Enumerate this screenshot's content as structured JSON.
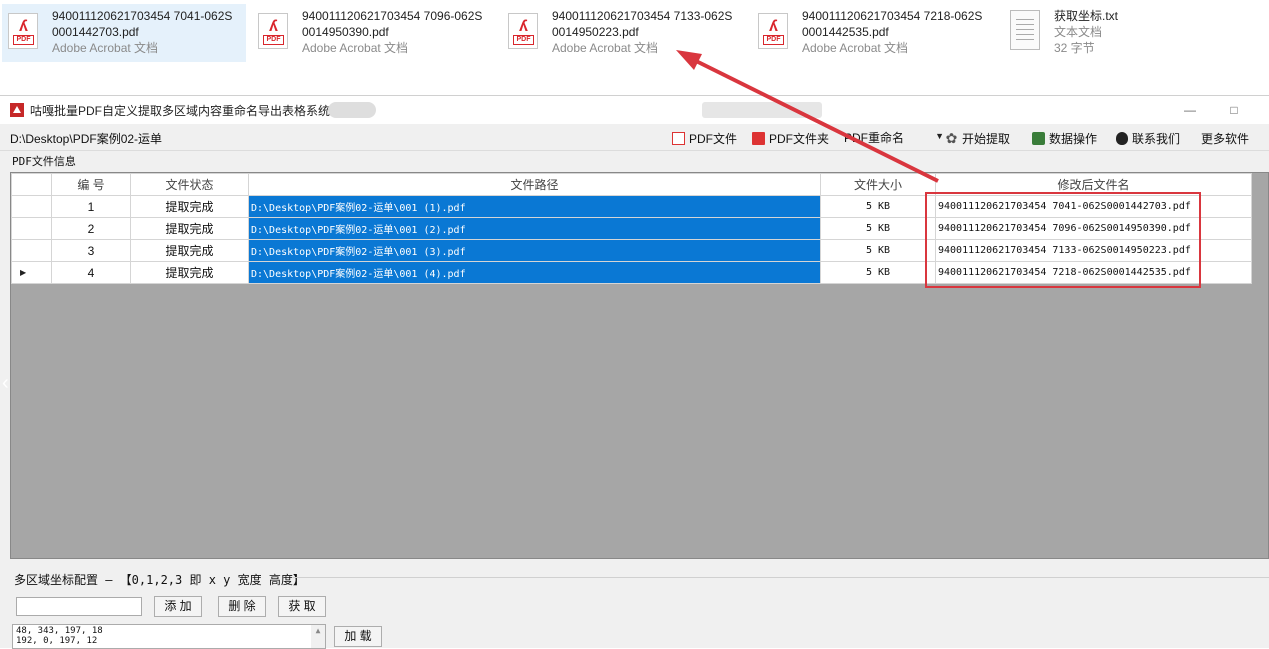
{
  "files": [
    {
      "name_line1": "94001112062170345470 41-062S",
      "name_line1_exact": "940011120621703454704 1-062S",
      "line1": "94001112062170345470​41-062S",
      "l1": "940011120621703454704​1-062S",
      "n1": "94001112062170345470",
      "text1": "940011120621703454704",
      "display1": "940011120621703454 7041-062S",
      "title_a": "94001112062170345470 41-062S",
      "a": "94001112062170345 47041-062S",
      "v1": "940011120621703454 7041-062S",
      "name_top": "940011120621703454 7041-062S",
      "name_bottom": "0001442703.pdf",
      "type": "Adobe Acrobat 文档",
      "kind": "pdf"
    }
  ],
  "file_strip": [
    {
      "line1": "940011120621703454 7041-062S",
      "line2": "0001442703.pdf",
      "type": "Adobe Acrobat 文档",
      "kind": "pdf",
      "selected": true
    },
    {
      "line1": "940011120621703454 7096-062S",
      "line2": "0014950390.pdf",
      "type": "Adobe Acrobat 文档",
      "kind": "pdf",
      "selected": false
    },
    {
      "line1": "940011120621703454 7133-062S",
      "line2": "0014950223.pdf",
      "type": "Adobe Acrobat 文档",
      "kind": "pdf",
      "selected": false
    },
    {
      "line1": "940011120621703454 7218-062S",
      "line2": "0001442535.pdf",
      "type": "Adobe Acrobat 文档",
      "kind": "pdf",
      "selected": false
    },
    {
      "line1": "获取坐标.txt",
      "line2": "文本文档",
      "type": "32 字节",
      "kind": "txt",
      "selected": false
    }
  ],
  "window": {
    "title": "咕嘎批量PDF自定义提取多区域内容重命名导出表格系统",
    "min_label": "—",
    "max_label": "□"
  },
  "toolbar": {
    "path": "D:\\Desktop\\PDF案例02-运单",
    "pdf_file": "PDF文件",
    "pdf_folder": "PDF文件夹",
    "rename_select": "PDF重命名",
    "start": "开始提取",
    "data_ops": "数据操作",
    "contact": "联系我们",
    "more": "更多软件"
  },
  "group_label": "PDF文件信息",
  "table": {
    "headers": [
      "编 号",
      "文件状态",
      "文件路径",
      "文件大小",
      "修改后文件名"
    ],
    "rows": [
      {
        "no": "1",
        "status": "提取完成",
        "path": "D:\\Desktop\\PDF案例02-运单\\001 (1).pdf",
        "size": "5 KB",
        "newname": "940011120621703454 7041-062S0001442703.pdf"
      },
      {
        "no": "2",
        "status": "提取完成",
        "path": "D:\\Desktop\\PDF案例02-运单\\001 (2).pdf",
        "size": "5 KB",
        "newname": "940011120621703454 7096-062S0014950390.pdf"
      },
      {
        "no": "3",
        "status": "提取完成",
        "path": "D:\\Desktop\\PDF案例02-运单\\001 (3).pdf",
        "size": "5 KB",
        "newname": "940011120621703454 7133-062S0014950223.pdf"
      },
      {
        "no": "4",
        "status": "提取完成",
        "path": "D:\\Desktop\\PDF案例02-运单\\001 (4).pdf",
        "size": "5 KB",
        "newname": "940011120621703454 7218-062S0001442535.pdf"
      }
    ],
    "current_row_marker": "▶"
  },
  "config": {
    "label": "多区域坐标配置 — 【0,1,2,3 即 x y 宽度 高度】",
    "input_value": "",
    "add": "添 加",
    "delete": "删 除",
    "get": "获 取",
    "load": "加 载",
    "coords_line1": "48, 343, 197, 18",
    "coords_line2": "192, 0, 197, 12"
  },
  "colors": {
    "selection": "#0a78d4",
    "highlight_box": "#d9363e",
    "grid_bg": "#a6a6a6"
  }
}
